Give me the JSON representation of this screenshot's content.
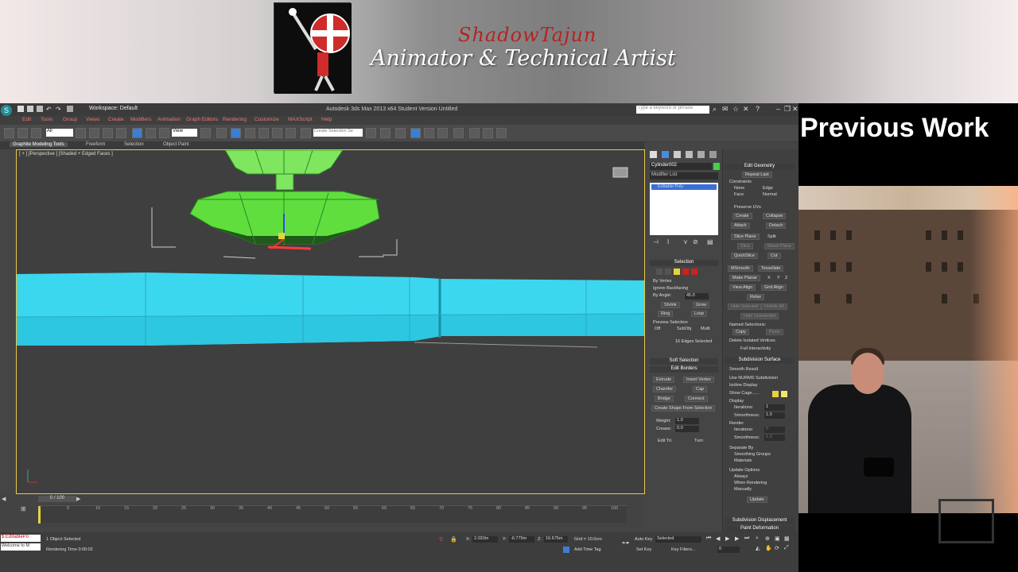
{
  "banner": {
    "name": "ShadowTajun",
    "role": "Animator & Technical Artist"
  },
  "side": {
    "heading": "Previous Work"
  },
  "max": {
    "workspace": "Workspace: Default",
    "window_title": "Autodesk 3ds Max 2013 x64    Student Version    Untitled",
    "search_placeholder": "Type a keyword or phrase",
    "menu": [
      "Edit",
      "Tools",
      "Group",
      "Views",
      "Create",
      "Modifiers",
      "Animation",
      "Graph Editors",
      "Rendering",
      "Customize",
      "MAXScript",
      "Help"
    ],
    "selection_set": "Create Selection Se",
    "ribbon_tabs": [
      "Graphite Modeling Tools",
      "Freeform",
      "Selection",
      "Object Paint"
    ],
    "viewport_label": "[ + ] [Perspective ] [Shaded + Edged Faces ]",
    "object_name": "Cylinder002",
    "modifier_list": "Modifier List",
    "modifier_stack_item": "Editable Poly",
    "accent_color": "#3bd7ef",
    "selection_color": "#43d04a",
    "selection_panel": {
      "title": "Selection",
      "by_vertex": "By Vertex",
      "ignore_backfacing": "Ignore Backfacing",
      "by_angle": "By Angle:",
      "angle_value": "45.0",
      "shrink": "Shrink",
      "grow": "Grow",
      "ring": "Ring",
      "loop": "Loop",
      "preview_selection": "Preview Selection",
      "off": "Off",
      "subobj": "SubObj",
      "multi": "Multi",
      "status": "16 Edges Selected"
    },
    "soft_selection": "Soft Selection",
    "edit_borders": {
      "title": "Edit Borders",
      "extrude": "Extrude",
      "insert_vertex": "Insert Vertex",
      "chamfer": "Chamfer",
      "cap": "Cap",
      "bridge": "Bridge",
      "connect": "Connect",
      "create_shape": "Create Shape From Selection",
      "weight_label": "Weight:",
      "weight": "1.0",
      "crease_label": "Crease:",
      "crease": "0.0",
      "edit_tri": "Edit Tri.",
      "turn": "Turn"
    },
    "geometry_panel": {
      "edit_geometry": "Edit Geometry",
      "repeat_last": "Repeat Last",
      "constraints": "Constraints",
      "none": "None",
      "edge": "Edge",
      "face": "Face",
      "normal": "Normal",
      "preserve_uvs": "Preserve UVs",
      "create": "Create",
      "collapse": "Collapse",
      "attach": "Attach",
      "detach": "Detach",
      "slice_plane": "Slice Plane",
      "split": "Split",
      "slice": "Slice",
      "reset_plane": "Reset Plane",
      "quickslice": "QuickSlice",
      "cut": "Cut",
      "msmooth": "MSmooth",
      "tessellate": "Tessellate",
      "make_planar": "Make Planar",
      "x": "X",
      "y": "Y",
      "z": "Z",
      "view_align": "View Align",
      "grid_align": "Grid Align",
      "relax": "Relax",
      "hide_selected": "Hide Selected",
      "unhide_all": "Unhide All",
      "hide_unselected": "Hide Unselected",
      "named_selections": "Named Selections:",
      "copy": "Copy",
      "paste": "Paste",
      "delete_isolated": "Delete Isolated Vertices",
      "full_interactivity": "Full Interactivity",
      "subdivision_surface": "Subdivision Surface",
      "smooth_result": "Smooth Result",
      "use_nurms": "Use NURMS Subdivision",
      "isoline_display": "Isoline Display",
      "show_cage": "Show Cage......",
      "display": "Display",
      "iterations_label": "Iterations:",
      "iterations": "1",
      "smoothness_label": "Smoothness:",
      "smoothness": "1.0",
      "render": "Render",
      "iterations2": "0",
      "smoothness2": "1.0",
      "separate_by": "Separate By",
      "smoothing_groups": "Smoothing Groups",
      "materials": "Materials",
      "update_options": "Update Options",
      "always": "Always",
      "when_rendering": "When Rendering",
      "manually": "Manually",
      "update": "Update",
      "subdivision_displacement": "Subdivision Displacement",
      "paint_deformation": "Paint Deformation"
    },
    "timeline": {
      "slider": "0 / 100",
      "ticks": [
        "0",
        "5",
        "10",
        "15",
        "20",
        "25",
        "30",
        "35",
        "40",
        "45",
        "50",
        "55",
        "60",
        "65",
        "70",
        "75",
        "80",
        "85",
        "90",
        "95",
        "100"
      ]
    },
    "status": {
      "maxscript": "$.EditablePo",
      "welcome": "Welcome to M",
      "object_selected": "1 Object Selected",
      "render_time": "Rendering Time  0:00:02",
      "x_label": "X:",
      "x": "2.033m",
      "y_label": "Y:",
      "y": "-6.779m",
      "z_label": "Z:",
      "z": "16.675m",
      "grid": "Grid = 10.0cm",
      "add_time_tag": "Add Time Tag",
      "auto_key": "Auto Key",
      "auto_key_value": "Selected",
      "set_key": "Set Key",
      "key_filters": "Key Filters...",
      "frame": "0"
    }
  }
}
